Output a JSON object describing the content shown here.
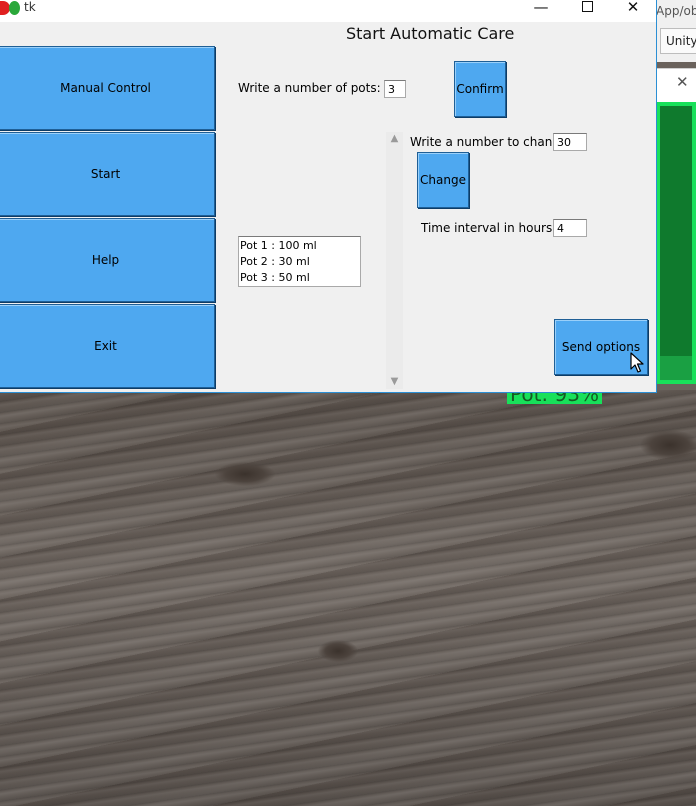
{
  "window": {
    "title": "tk",
    "controls": {
      "minimize": "—",
      "close": "✕"
    }
  },
  "background_app": {
    "path_fragment": "App/ob",
    "tab_label": "Unity",
    "close_glyph": "✕",
    "camera_label": "Pot: 93%",
    "colors": {
      "highlight": "#18e05a"
    }
  },
  "nav": {
    "items": [
      {
        "label": "Manual Control"
      },
      {
        "label": "Start"
      },
      {
        "label": "Help"
      },
      {
        "label": "Exit"
      }
    ]
  },
  "page": {
    "title": "Start Automatic Care"
  },
  "pots": {
    "label": "Write a number of pots:",
    "value": "3",
    "confirm_label": "Confirm"
  },
  "pot_list": {
    "items": [
      "Pot 1 : 100 ml",
      "Pot 2 : 30 ml",
      "Pot 3 : 50 ml"
    ]
  },
  "change": {
    "label": "Write a number to change:",
    "value": "30",
    "button_label": "Change"
  },
  "interval": {
    "label": "Time interval in hours:",
    "value": "4"
  },
  "send": {
    "label": "Send options"
  },
  "scrollbar": {
    "up": "▲",
    "down": "▼"
  },
  "colors": {
    "button_blue": "#4ea8f0",
    "window_bg": "#f0f0f0",
    "window_border": "#2b8fd4"
  }
}
